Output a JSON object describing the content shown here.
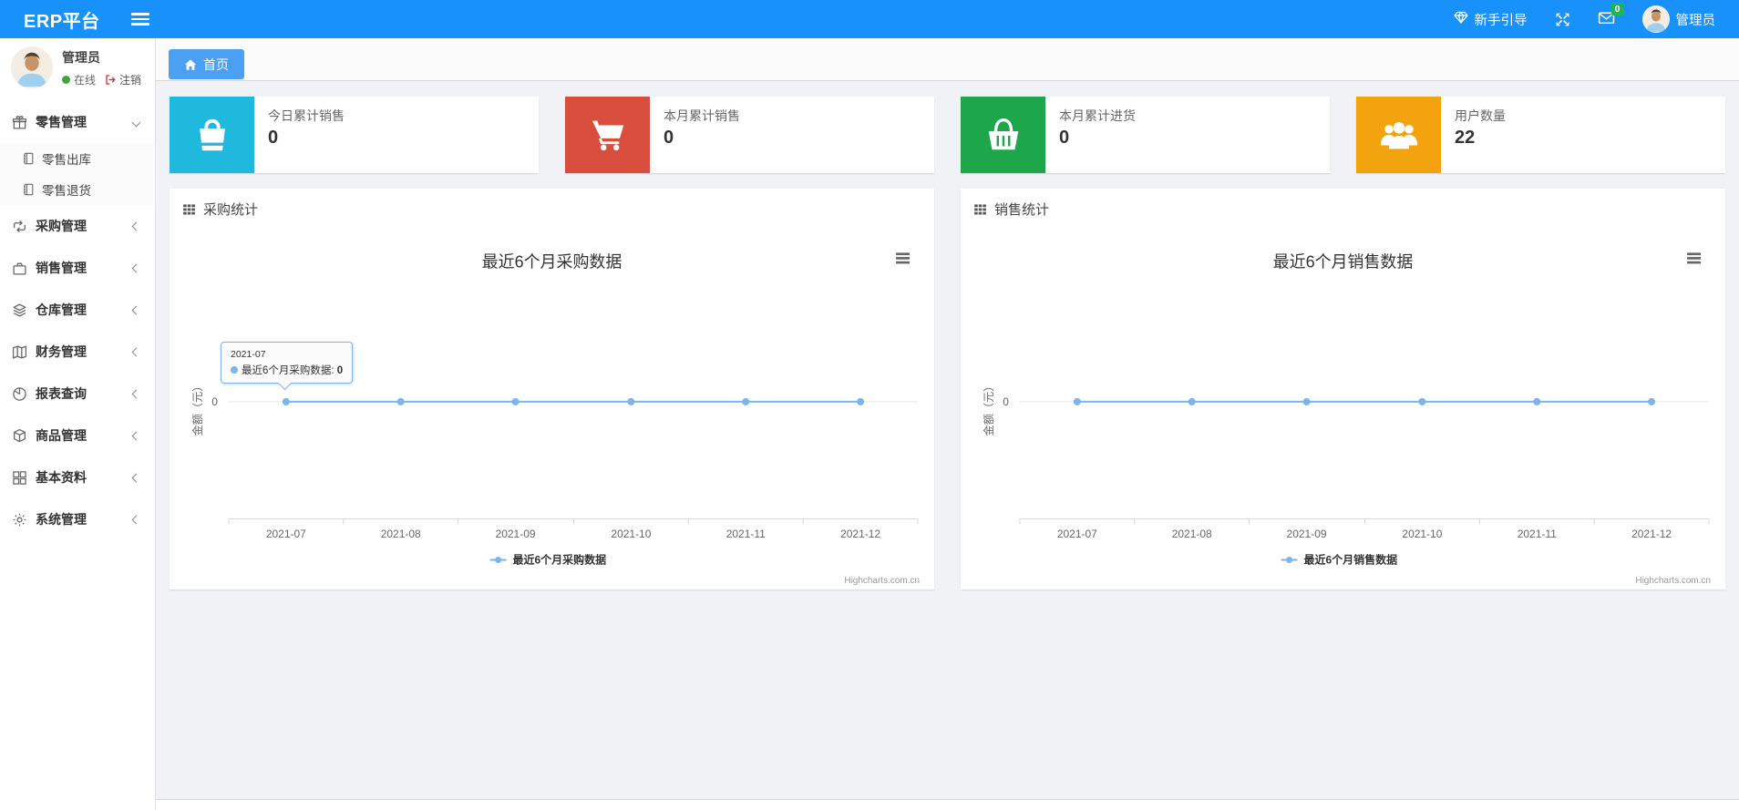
{
  "colors": {
    "navbar": "#1991fa",
    "active_tab": "#4aa0f2",
    "series": "#7cb5ec",
    "badge": "#1db45a"
  },
  "navbar": {
    "brand": "ERP平台",
    "guide_label": "新手引导",
    "mail_badge": "0",
    "username": "管理员"
  },
  "sidebar": {
    "user": {
      "name": "管理员",
      "status": "在线",
      "logout": "注销"
    },
    "menu": [
      {
        "label": "零售管理",
        "icon": "gift-icon",
        "state": "expanded",
        "children": [
          {
            "label": "零售出库",
            "icon": "journal-icon"
          },
          {
            "label": "零售退货",
            "icon": "journal-icon"
          }
        ]
      },
      {
        "label": "采购管理",
        "icon": "repeat-icon",
        "state": "collapsed"
      },
      {
        "label": "销售管理",
        "icon": "briefcase-icon",
        "state": "collapsed"
      },
      {
        "label": "仓库管理",
        "icon": "layers-icon",
        "state": "collapsed"
      },
      {
        "label": "财务管理",
        "icon": "map-icon",
        "state": "collapsed"
      },
      {
        "label": "报表查询",
        "icon": "pie-chart-icon",
        "state": "collapsed"
      },
      {
        "label": "商品管理",
        "icon": "box-icon",
        "state": "collapsed"
      },
      {
        "label": "基本资料",
        "icon": "grid-icon",
        "state": "collapsed"
      },
      {
        "label": "系统管理",
        "icon": "gear-icon",
        "state": "collapsed"
      }
    ]
  },
  "tabs": {
    "home_label": "首页"
  },
  "stats": [
    {
      "label": "今日累计销售",
      "value": "0",
      "color": "#1eb9dc",
      "icon": "shopping-bag-icon"
    },
    {
      "label": "本月累计销售",
      "value": "0",
      "color": "#d94d3d",
      "icon": "shopping-cart-icon"
    },
    {
      "label": "本月累计进货",
      "value": "0",
      "color": "#1ea64a",
      "icon": "shopping-basket-icon"
    },
    {
      "label": "用户数量",
      "value": "22",
      "color": "#f2a30e",
      "icon": "users-icon"
    }
  ],
  "panels": [
    {
      "title": "采购统计"
    },
    {
      "title": "销售统计"
    }
  ],
  "chart_data": [
    {
      "type": "line",
      "title": "最近6个月采购数据",
      "categories": [
        "2021-07",
        "2021-08",
        "2021-09",
        "2021-10",
        "2021-11",
        "2021-12"
      ],
      "series": [
        {
          "name": "最近6个月采购数据",
          "color": "#7cb5ec",
          "values": [
            0,
            0,
            0,
            0,
            0,
            0
          ]
        }
      ],
      "xlabel": "",
      "ylabel": "金额（元）",
      "yticks": [
        "0"
      ],
      "grid": true,
      "legend_position": "bottom",
      "credit": "Highcharts.com.cn",
      "tooltip": {
        "category": "2021-07",
        "label": "最近6个月采购数据: ",
        "value": "0"
      }
    },
    {
      "type": "line",
      "title": "最近6个月销售数据",
      "categories": [
        "2021-07",
        "2021-08",
        "2021-09",
        "2021-10",
        "2021-11",
        "2021-12"
      ],
      "series": [
        {
          "name": "最近6个月销售数据",
          "color": "#7cb5ec",
          "values": [
            0,
            0,
            0,
            0,
            0,
            0
          ]
        }
      ],
      "xlabel": "",
      "ylabel": "金额（元）",
      "yticks": [
        "0"
      ],
      "grid": true,
      "legend_position": "bottom",
      "credit": "Highcharts.com.cn"
    }
  ]
}
